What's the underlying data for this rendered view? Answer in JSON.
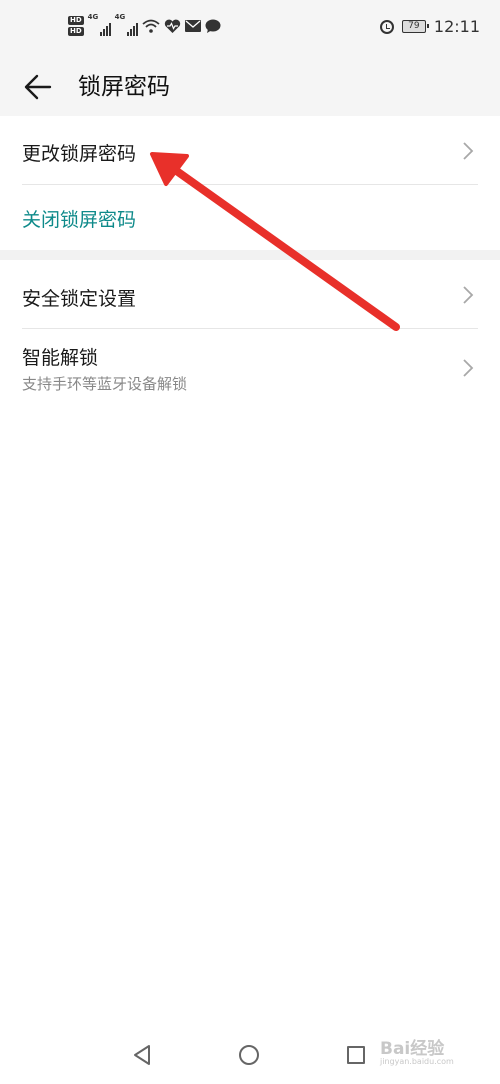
{
  "status_bar": {
    "hd_labels": [
      "HD",
      "HD"
    ],
    "network_labels": [
      "4G",
      "4G"
    ],
    "battery": "79",
    "time": "12:11"
  },
  "header": {
    "back_icon": "arrow-left-icon",
    "title": "锁屏密码"
  },
  "section1": {
    "change_label": "更改锁屏密码",
    "close_label": "关闭锁屏密码"
  },
  "section2": {
    "security_lock_label": "安全锁定设置",
    "smart_unlock_label": "智能解锁",
    "smart_unlock_sub": "支持手环等蓝牙设备解锁"
  },
  "nav_bar": {
    "icons": [
      "triangle-back-icon",
      "circle-home-icon",
      "square-recent-icon"
    ]
  },
  "watermark": {
    "text": "Bai经验",
    "sub": "jingyan.baidu.com"
  },
  "colors": {
    "accent_teal": "#0e8a8a",
    "annotation_red": "#e8302a",
    "background": "#ffffff",
    "header_bg": "#f5f5f5"
  }
}
